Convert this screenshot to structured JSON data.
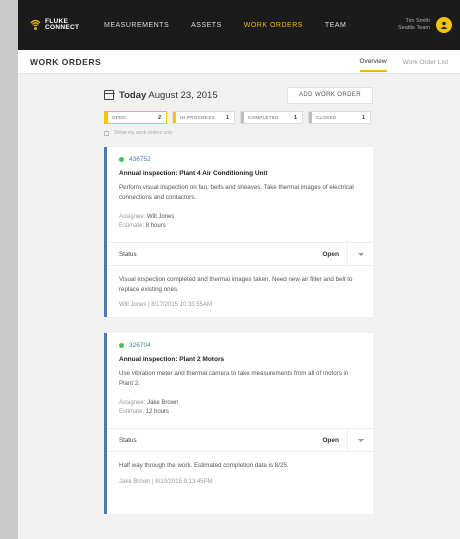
{
  "topbar": {
    "logo_line1": "FLUKE",
    "logo_line2": "CONNECT",
    "nav": [
      {
        "label": "MEASUREMENTS"
      },
      {
        "label": "ASSETS"
      },
      {
        "label": "WORK ORDERS"
      },
      {
        "label": "TEAM"
      }
    ],
    "user_name": "Tim Smith",
    "user_team": "Seattle Team",
    "accent": "#f5b400"
  },
  "subheader": {
    "title": "WORK ORDERS",
    "tabs": [
      {
        "label": "Overview"
      },
      {
        "label": "Work Order List"
      }
    ]
  },
  "date": {
    "today": "Today",
    "value": "August 23, 2015"
  },
  "add_button": "ADD WORK ORDER",
  "filters": [
    {
      "label": "OPEN",
      "count": "2",
      "color": "#f5c400"
    },
    {
      "label": "IN-PROGRESS",
      "count": "1",
      "color": "#f5c400"
    },
    {
      "label": "COMPLETED",
      "count": "1",
      "color": "#bdbdbd"
    },
    {
      "label": "CLOSED",
      "count": "1",
      "color": "#bdbdbd"
    }
  ],
  "show_mine": "Show my work orders only",
  "cards": [
    {
      "id": "436752",
      "title": "Annual inspection: Plant 4 Air Conditioning Unit",
      "desc": "Perform visual inspection on fan, belts and sheaves. Take thermal images of electrical connections and contactors.",
      "assignee_label": "Assignee:",
      "assignee": "Will Jones",
      "estimate_label": "Estimate:",
      "estimate": "8 hours",
      "status_label": "Status",
      "status": "Open",
      "note": "Visual inspection completed and thermal images taken. Need new air filter and belt to replace existing ones.",
      "note_author": "Will Jones",
      "note_time": "8/17/2015  10:33:55AM"
    },
    {
      "id": "326704",
      "title": "Annual Inspection: Plant 2 Motors",
      "desc": "Use vibration meter and thermal camera to take measurements from all of motors in Plant 2.",
      "assignee_label": "Assignee:",
      "assignee": "Jake Brown",
      "estimate_label": "Estimate:",
      "estimate": "12 hours",
      "status_label": "Status",
      "status": "Open",
      "note": "Half way through the work. Estimated completion date is 8/25.",
      "note_author": "Jake Brown",
      "note_time": "8/10/2015  9:13:45PM"
    }
  ]
}
